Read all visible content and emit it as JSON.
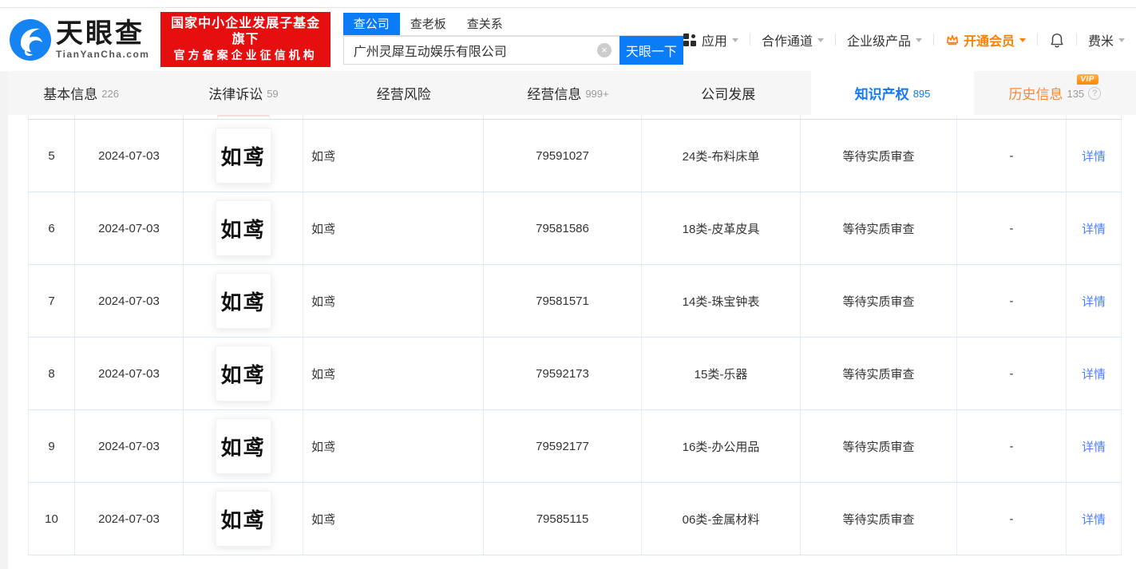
{
  "brand": {
    "name": "天眼查",
    "domain": "TianYanCha.com",
    "badge_line1": "国家中小企业发展子基金旗下",
    "badge_line2": "官方备案企业征信机构"
  },
  "search": {
    "tabs": [
      {
        "label": "查公司"
      },
      {
        "label": "查老板"
      },
      {
        "label": "查关系"
      }
    ],
    "active_tab": "查公司",
    "value": "广州灵犀互动娱乐有限公司",
    "button_label": "天眼一下"
  },
  "top_menu": {
    "app": "应用",
    "partner": "合作通道",
    "enterprise": "企业级产品",
    "vip": "开通会员",
    "user": "费米"
  },
  "nav_tabs": [
    {
      "label": "基本信息",
      "count": "226"
    },
    {
      "label": "法律诉讼",
      "count": "59"
    },
    {
      "label": "经营风险",
      "count": ""
    },
    {
      "label": "经营信息",
      "count": "999+"
    },
    {
      "label": "公司发展",
      "count": ""
    },
    {
      "label": "知识产权",
      "count": "895"
    },
    {
      "label": "历史信息",
      "count": "135",
      "vip_badge": "VIP"
    }
  ],
  "active_nav_tab": "知识产权",
  "icons": {
    "clear": "×",
    "help": "?"
  },
  "table": {
    "rows": [
      {
        "index": "5",
        "date": "2024-07-03",
        "image_text": "如鸢",
        "name": "如鸢",
        "reg_no": "79591027",
        "category": "24类-布料床单",
        "status": "等待实质审查",
        "extra": "-",
        "action": "详情"
      },
      {
        "index": "6",
        "date": "2024-07-03",
        "image_text": "如鸢",
        "name": "如鸢",
        "reg_no": "79581586",
        "category": "18类-皮革皮具",
        "status": "等待实质审查",
        "extra": "-",
        "action": "详情"
      },
      {
        "index": "7",
        "date": "2024-07-03",
        "image_text": "如鸢",
        "name": "如鸢",
        "reg_no": "79581571",
        "category": "14类-珠宝钟表",
        "status": "等待实质审查",
        "extra": "-",
        "action": "详情"
      },
      {
        "index": "8",
        "date": "2024-07-03",
        "image_text": "如鸢",
        "name": "如鸢",
        "reg_no": "79592173",
        "category": "15类-乐器",
        "status": "等待实质审查",
        "extra": "-",
        "action": "详情"
      },
      {
        "index": "9",
        "date": "2024-07-03",
        "image_text": "如鸢",
        "name": "如鸢",
        "reg_no": "79592177",
        "category": "16类-办公用品",
        "status": "等待实质审查",
        "extra": "-",
        "action": "详情"
      },
      {
        "index": "10",
        "date": "2024-07-03",
        "image_text": "如鸢",
        "name": "如鸢",
        "reg_no": "79585115",
        "category": "06类-金属材料",
        "status": "等待实质审查",
        "extra": "-",
        "action": "详情"
      }
    ]
  },
  "colors": {
    "brand_blue": "#0b7cf8",
    "link_blue": "#4d7ef5",
    "badge_red": "#e60f0f",
    "vip_orange": "#ff8a00",
    "history_orange": "#f9873a"
  }
}
